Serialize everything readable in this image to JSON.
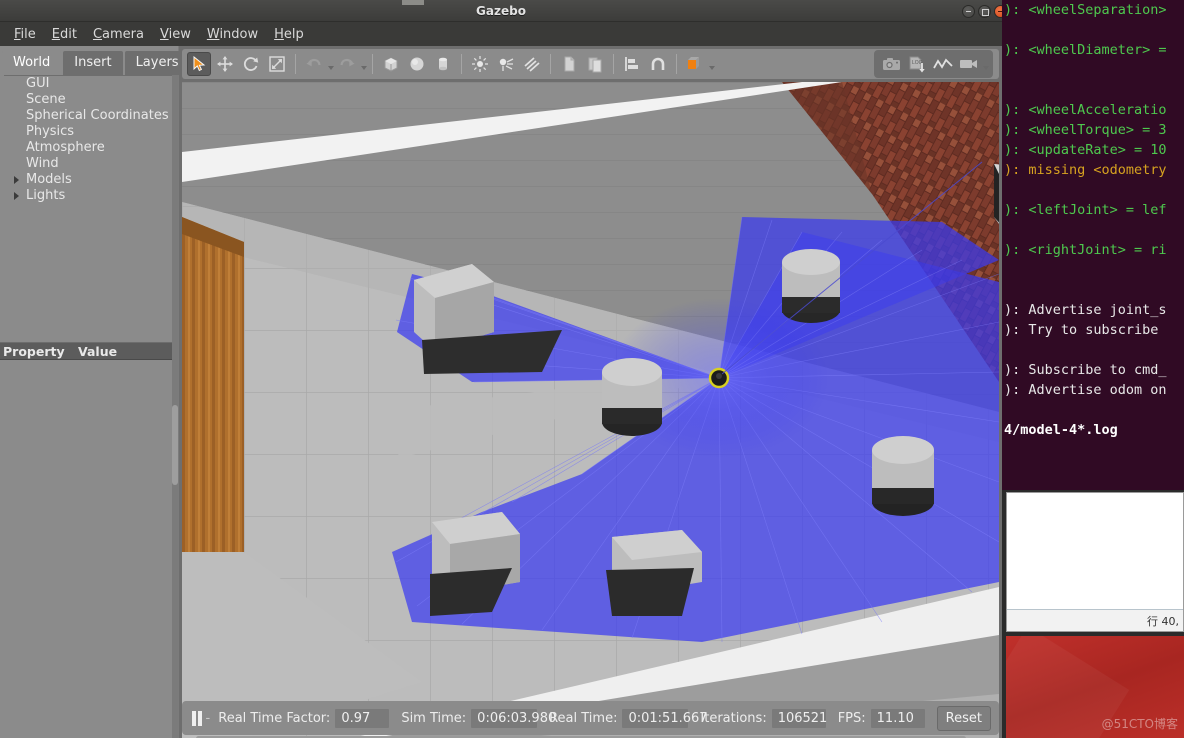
{
  "window": {
    "title": "Gazebo",
    "controls": [
      {
        "name": "minimize-button",
        "label": "–"
      },
      {
        "name": "maximize-button",
        "label": "□"
      },
      {
        "name": "close-button",
        "label": "×"
      }
    ]
  },
  "menubar": {
    "items": [
      {
        "mnemonic": "F",
        "rest": "ile",
        "label": "File"
      },
      {
        "mnemonic": "E",
        "rest": "dit",
        "label": "Edit"
      },
      {
        "mnemonic": "C",
        "rest": "amera",
        "label": "Camera"
      },
      {
        "mnemonic": "V",
        "rest": "iew",
        "label": "View"
      },
      {
        "mnemonic": "W",
        "rest": "indow",
        "label": "Window"
      },
      {
        "mnemonic": "H",
        "rest": "elp",
        "label": "Help"
      }
    ]
  },
  "left_panel": {
    "tabs": [
      {
        "label": "World",
        "active": true
      },
      {
        "label": "Insert",
        "active": false
      },
      {
        "label": "Layers",
        "active": false
      }
    ],
    "tree": [
      {
        "label": "GUI",
        "expandable": false
      },
      {
        "label": "Scene",
        "expandable": false
      },
      {
        "label": "Spherical Coordinates",
        "expandable": false
      },
      {
        "label": "Physics",
        "expandable": false
      },
      {
        "label": "Atmosphere",
        "expandable": false
      },
      {
        "label": "Wind",
        "expandable": false
      },
      {
        "label": "Models",
        "expandable": true
      },
      {
        "label": "Lights",
        "expandable": true
      }
    ],
    "property_table": {
      "columns": [
        "Property",
        "Value"
      ],
      "rows": []
    }
  },
  "toolbar": {
    "left_tools": [
      {
        "name": "select-arrow-tool",
        "icon": "cursor-arrow-icon",
        "selected": true
      },
      {
        "name": "translate-tool",
        "icon": "move-arrows-icon",
        "selected": false
      },
      {
        "name": "rotate-tool",
        "icon": "rotate-icon",
        "selected": false
      },
      {
        "name": "scale-tool",
        "icon": "scale-icon",
        "selected": false
      },
      {
        "name": "undo-button",
        "icon": "undo-arrow-icon",
        "selected": false
      },
      {
        "name": "redo-button",
        "icon": "redo-arrow-icon",
        "selected": false
      },
      {
        "name": "insert-box-button",
        "icon": "box-icon",
        "selected": false
      },
      {
        "name": "insert-sphere-button",
        "icon": "sphere-icon",
        "selected": false
      },
      {
        "name": "insert-cylinder-button",
        "icon": "cylinder-icon",
        "selected": false
      },
      {
        "name": "point-light-button",
        "icon": "point-light-icon",
        "selected": false
      },
      {
        "name": "spot-light-button",
        "icon": "spot-light-icon",
        "selected": false
      },
      {
        "name": "directional-light-button",
        "icon": "directional-light-icon",
        "selected": false
      },
      {
        "name": "copy-button",
        "icon": "copy-icon",
        "selected": false
      },
      {
        "name": "paste-button",
        "icon": "paste-icon",
        "selected": false
      },
      {
        "name": "align-button",
        "icon": "align-icon",
        "selected": false
      },
      {
        "name": "snap-button",
        "icon": "magnet-icon",
        "selected": false
      },
      {
        "name": "view-mode-button",
        "icon": "view-cube-icon",
        "selected": true
      }
    ],
    "right_tools": [
      {
        "name": "screenshot-button",
        "icon": "camera-icon"
      },
      {
        "name": "save-log-button",
        "icon": "log-save-icon"
      },
      {
        "name": "plot-button",
        "icon": "plot-line-icon"
      },
      {
        "name": "record-video-button",
        "icon": "video-camera-icon"
      }
    ],
    "accent_color": "#f08010"
  },
  "statusbar": {
    "pause_icon": "pause-icon",
    "step_label": "-",
    "fields": [
      {
        "label": "Real Time Factor:",
        "value": "0.97"
      },
      {
        "label": "Sim Time:",
        "value": "0:06:03.980"
      },
      {
        "label": "Real Time:",
        "value": "0:01:51.667"
      },
      {
        "label": "Iterations:",
        "value": "106521"
      },
      {
        "label": "FPS:",
        "value": "11.10"
      }
    ],
    "reset_label": "Reset"
  },
  "scene": {
    "description": "Gazebo 3D viewport: gray tiled floor, gray walls, wooden door on the left, brick wall upper right, white baseboards, gray box and cylinder obstacles casting dark shadows, and a blue laser-scan fan emanating from a small robot at center.",
    "laser_color": "#3b3bf0",
    "floor_color": "#b8b8b8",
    "wall_color": "#8c8c8c",
    "obstacle_color": "#bdbdbd",
    "shadow_color": "#2a2a2a",
    "door_color": "#b5712c",
    "brick_color": "#6b2f25"
  },
  "terminal": {
    "lines": [
      {
        "text": "): <wheelSeparation>",
        "color": "green"
      },
      {
        "text": "",
        "color": "green"
      },
      {
        "text": "): <wheelDiameter> =",
        "color": "green"
      },
      {
        "text": "",
        "color": "green"
      },
      {
        "text": "",
        "color": "green"
      },
      {
        "text": "): <wheelAcceleratio",
        "color": "green"
      },
      {
        "text": "): <wheelTorque> = 3",
        "color": "green"
      },
      {
        "text": "): <updateRate> = 10",
        "color": "green"
      },
      {
        "text": "): missing <odometry",
        "color": "yellow"
      },
      {
        "text": "",
        "color": "green"
      },
      {
        "text": "): <leftJoint> = lef",
        "color": "green"
      },
      {
        "text": "",
        "color": "green"
      },
      {
        "text": "): <rightJoint> = ri",
        "color": "green"
      },
      {
        "text": "",
        "color": "green"
      },
      {
        "text": "",
        "color": "green"
      },
      {
        "text": "): Advertise joint_s",
        "color": "white"
      },
      {
        "text": "): Try to subscribe",
        "color": "white"
      },
      {
        "text": "",
        "color": "white"
      },
      {
        "text": "): Subscribe to cmd_",
        "color": "white"
      },
      {
        "text": "): Advertise odom on",
        "color": "white"
      },
      {
        "text": "",
        "color": "white"
      },
      {
        "text": "4/model-4*.log",
        "color": "boldwhite"
      }
    ]
  },
  "editor": {
    "status_text": "行 40,"
  },
  "red_panel": {
    "watermark": "@51CTO博客"
  }
}
